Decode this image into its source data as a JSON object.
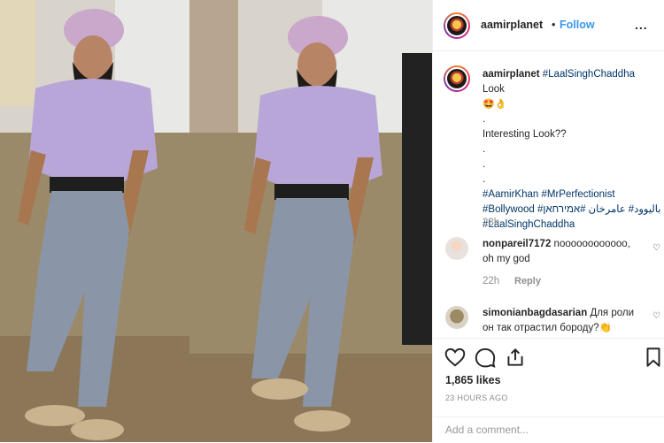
{
  "post": {
    "username": "aamirplanet",
    "follow_separator": "•",
    "follow_label": "Follow",
    "more_label": "...",
    "caption": {
      "username": "aamirplanet",
      "hashtag_title": "#LaalSinghChaddha",
      "text_after_tag": "Look",
      "emojis": "🤩👌",
      "dot1": ".",
      "line2": "Interesting Look??",
      "dot2": ".",
      "dot3": ".",
      "dot4": ".",
      "tags_line1": "#AamirKhan #MrPerfectionist",
      "tags_line2": "#Bollywood #باليوود# عامرخان #אמירחאן",
      "tags_line3": "#LaalSinghChaddha"
    },
    "caption_time": "23h",
    "comments": [
      {
        "username": "nonpareil7172",
        "text": "noooooooooooo, oh my god",
        "time": "22h",
        "reply_label": "Reply",
        "like_icon": "heart-outline-icon"
      },
      {
        "username": "simonianbagdasarian",
        "text": "Для роли он так отрастил бороду?👏",
        "like_icon": "heart-outline-icon"
      }
    ],
    "likes_text": "1,865 likes",
    "time_ago": "23 HOURS AGO",
    "add_comment_placeholder": "Add a comment..."
  },
  "icons": {
    "like": "heart-icon",
    "comment": "comment-icon",
    "share": "share-icon",
    "save": "bookmark-icon"
  },
  "colors": {
    "accent": "#3897f0",
    "hashtag": "#003569",
    "muted": "#8e8e8e",
    "border": "#efefef",
    "turban": "#c9a8cc",
    "shirt": "#b9a6d8",
    "trousers": "#8a96a8"
  }
}
